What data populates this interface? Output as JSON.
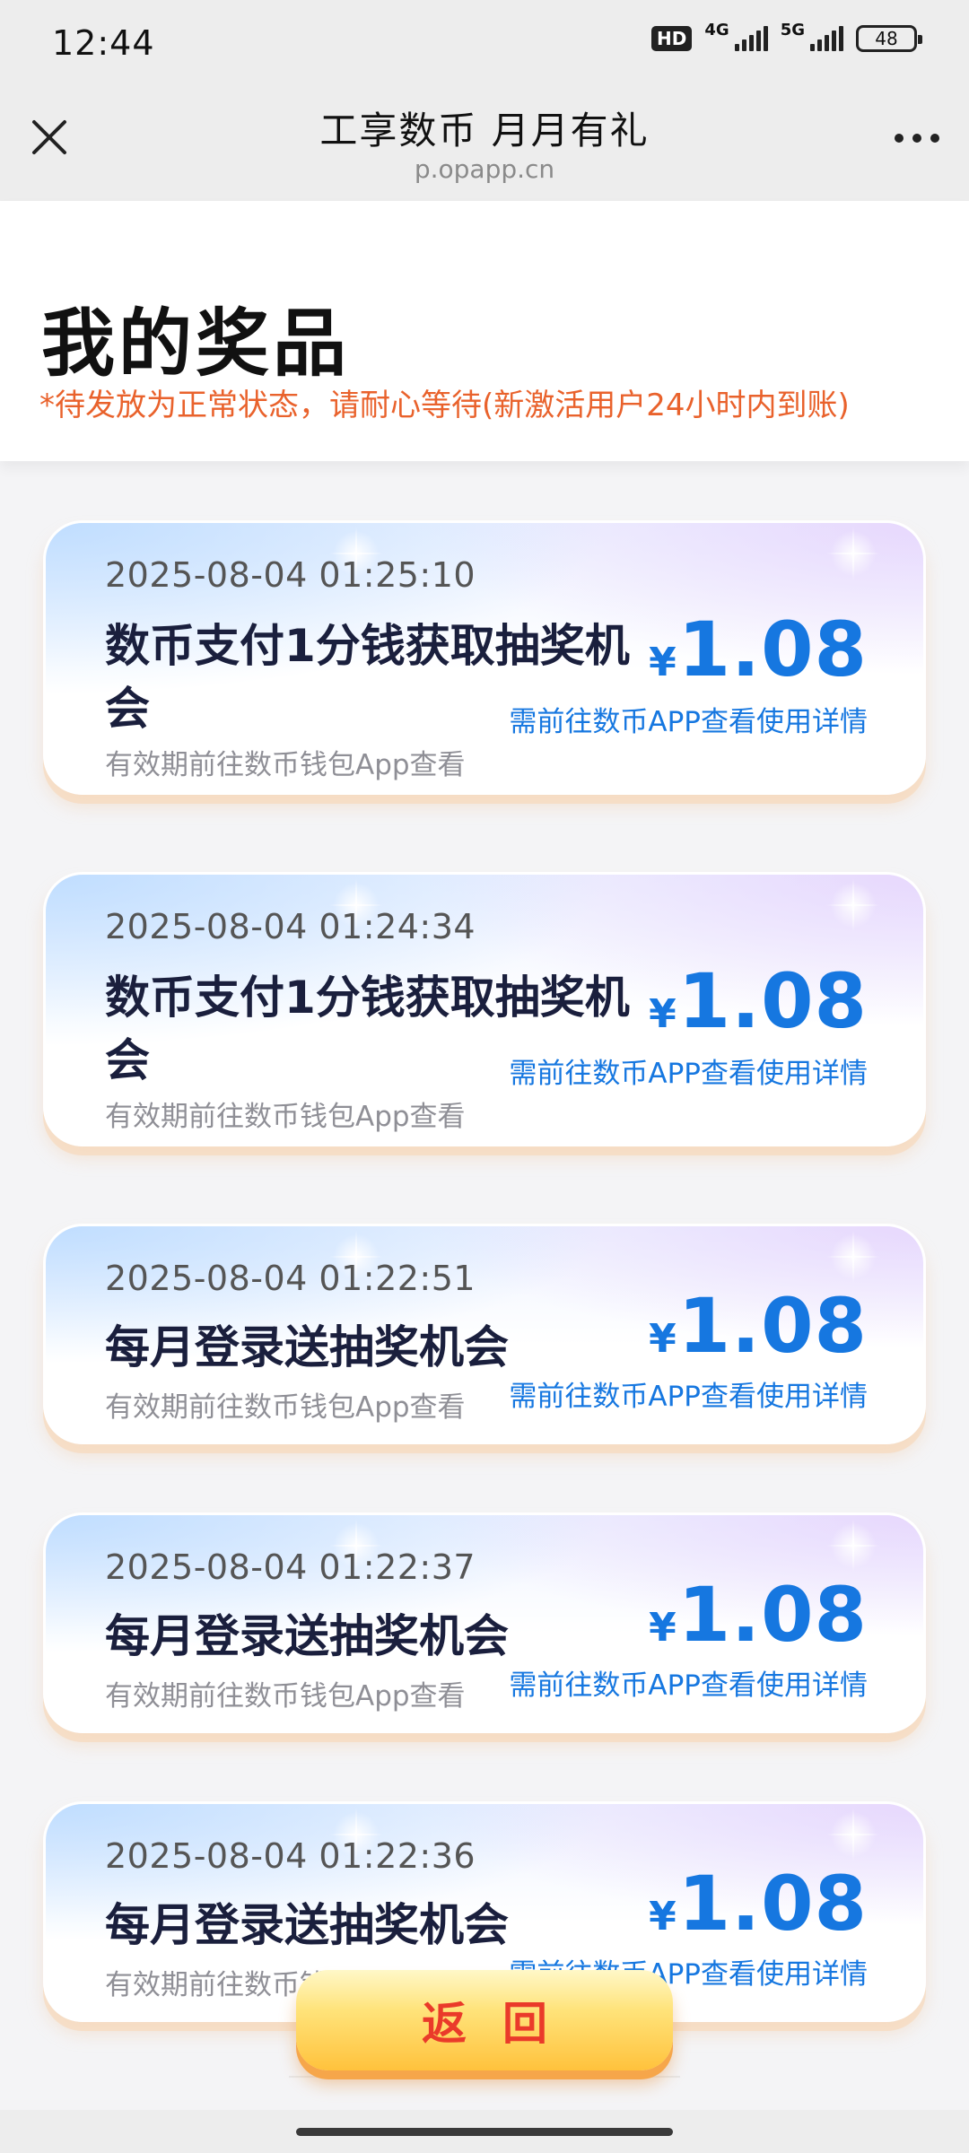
{
  "status_bar": {
    "time": "12:44",
    "hd_badge": "HD",
    "network_1": "4G",
    "network_2": "5G",
    "battery": "48"
  },
  "nav": {
    "title": "工享数币 月月有礼",
    "url": "p.opapp.cn"
  },
  "header": {
    "title": "我的奖品",
    "notice": "*待发放为正常状态，请耐心等待(新激活用户24小时内到账)"
  },
  "prizes": [
    {
      "date": "2025-08-04 01:25:10",
      "title": "数币支付1分钱获取抽奖机会",
      "validity": "有效期前往数币钱包App查看",
      "currency": "¥",
      "amount": "1.08",
      "detail": "需前往数币APP查看使用详情"
    },
    {
      "date": "2025-08-04 01:24:34",
      "title": "数币支付1分钱获取抽奖机会",
      "validity": "有效期前往数币钱包App查看",
      "currency": "¥",
      "amount": "1.08",
      "detail": "需前往数币APP查看使用详情"
    },
    {
      "date": "2025-08-04 01:22:51",
      "title": "每月登录送抽奖机会",
      "validity": "有效期前往数币钱包App查看",
      "currency": "¥",
      "amount": "1.08",
      "detail": "需前往数币APP查看使用详情"
    },
    {
      "date": "2025-08-04 01:22:37",
      "title": "每月登录送抽奖机会",
      "validity": "有效期前往数币钱包App查看",
      "currency": "¥",
      "amount": "1.08",
      "detail": "需前往数币APP查看使用详情"
    },
    {
      "date": "2025-08-04 01:22:36",
      "title": "每月登录送抽奖机会",
      "validity": "有效期前往数币钱包App查看",
      "currency": "¥",
      "amount": "1.08",
      "detail": "需前往数币APP查看使用详情"
    }
  ],
  "return_button": "返回",
  "colors": {
    "accent_blue": "#1677e0",
    "notice_orange": "#e9622c",
    "button_red": "#ea3a2a"
  }
}
